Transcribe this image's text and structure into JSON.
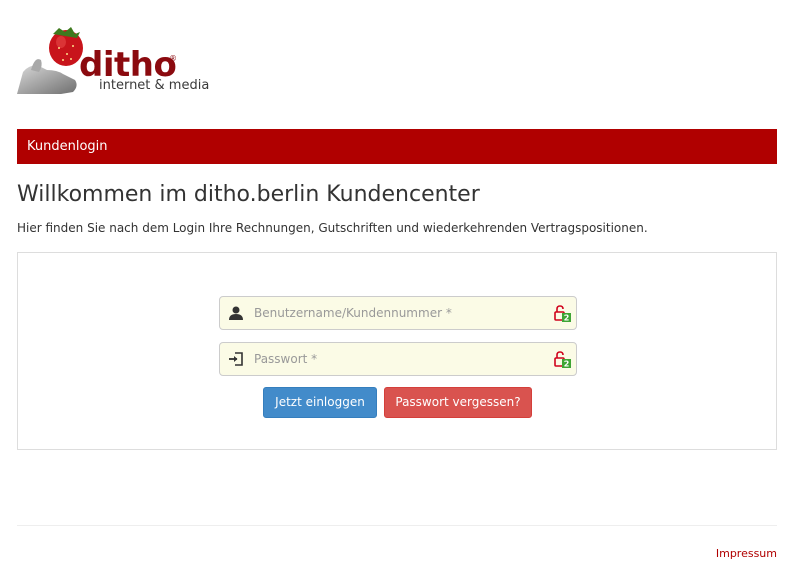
{
  "brand": {
    "name": "ditho",
    "registered": "®",
    "tagline": "internet & media"
  },
  "panel": {
    "heading": "Kundenlogin"
  },
  "main": {
    "title": "Willkommen im ditho.berlin Kundencenter",
    "intro": "Hier finden Sie nach dem Login Ihre Rechnungen, Gutschriften und wiederkehrenden Vertragspositionen."
  },
  "form": {
    "username": {
      "placeholder": "Benutzername/Kundennummer *",
      "value": "",
      "icon": "user-icon"
    },
    "password": {
      "placeholder": "Passwort *",
      "value": "",
      "icon": "login-icon"
    },
    "password_manager_icon": "password-manager-icon",
    "password_manager_badge": "2",
    "login_button": "Jetzt einloggen",
    "forgot_button": "Passwort vergessen?"
  },
  "footer": {
    "impressum": "Impressum"
  },
  "colors": {
    "brand_red": "#b00000",
    "logo_red": "#8b0a0f",
    "primary": "#428bca",
    "danger": "#d9534f",
    "field_bg": "#fbfbe6"
  }
}
